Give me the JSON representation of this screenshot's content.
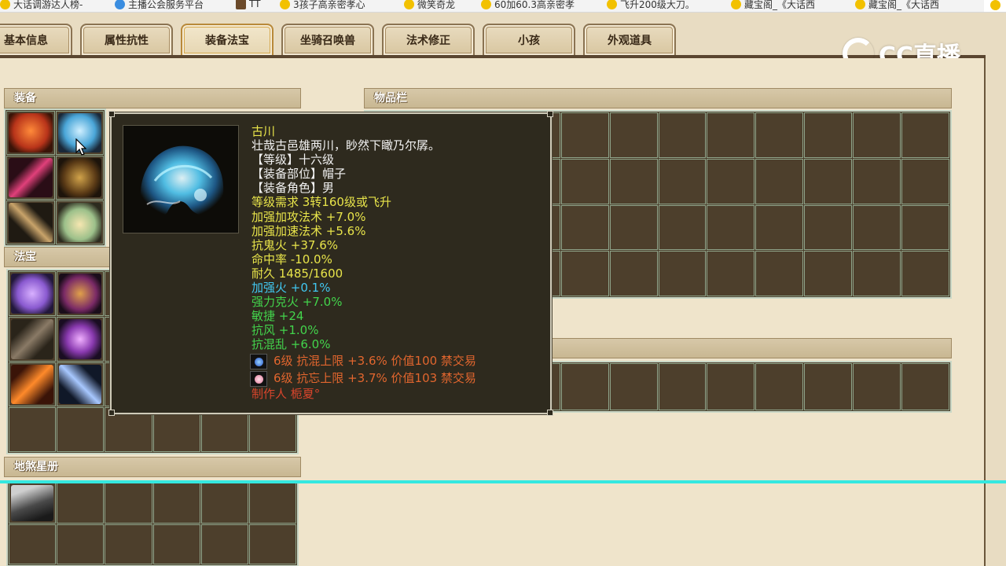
{
  "bookmarks": [
    {
      "label": "大话调游达人榜-",
      "icon": "star-icon"
    },
    {
      "label": "主播公会服务平台",
      "icon": "globe-icon"
    },
    {
      "label": "TT",
      "icon": "game-icon"
    },
    {
      "label": "3孩子高亲密孝心",
      "icon": "star-icon"
    },
    {
      "label": "微笑奇龙",
      "icon": "star-icon"
    },
    {
      "label": "60加60.3高亲密孝",
      "icon": "star-icon"
    },
    {
      "label": "飞升200级大刀。",
      "icon": "star-icon"
    },
    {
      "label": "藏宝阁_《大话西",
      "icon": "star-icon"
    },
    {
      "label": "藏宝阁_《大话西",
      "icon": "star-icon"
    }
  ],
  "tabs": [
    {
      "label": "基本信息"
    },
    {
      "label": "属性抗性"
    },
    {
      "label": "装备法宝"
    },
    {
      "label": "坐骑召唤兽"
    },
    {
      "label": "法术修正"
    },
    {
      "label": "小孩"
    },
    {
      "label": "外观道具"
    }
  ],
  "active_tab": "装备法宝",
  "logo": {
    "text": "CC直播"
  },
  "sections": {
    "equipment": "装备",
    "fabao": "法宝",
    "inventory": "物品栏",
    "disha": "地煞星册"
  },
  "tooltip": {
    "name": "古川",
    "description": "壮哉古邑雄两川，眇然下瞰乃尔孱。",
    "lines": [
      {
        "text": "【等级】十六级",
        "color": "white"
      },
      {
        "text": "【装备部位】帽子",
        "color": "white"
      },
      {
        "text": "【装备角色】男",
        "color": "white"
      },
      {
        "text": "等级需求 3转160级或飞升",
        "color": "yellow"
      },
      {
        "text": "加强加攻法术 +7.0%",
        "color": "yellow"
      },
      {
        "text": "加强加速法术 +5.6%",
        "color": "yellow"
      },
      {
        "text": "抗鬼火 +37.6%",
        "color": "yellow"
      },
      {
        "text": "命中率 -10.0%",
        "color": "yellow"
      },
      {
        "text": "耐久 1485/1600",
        "color": "yellow"
      },
      {
        "text": "加强火 +0.1%",
        "color": "blue"
      },
      {
        "text": "强力克火 +7.0%",
        "color": "green"
      },
      {
        "text": "敏捷 +24",
        "color": "green"
      },
      {
        "text": "抗风 +1.0%",
        "color": "green"
      },
      {
        "text": "抗混乱 +6.0%",
        "color": "green"
      }
    ],
    "gems": [
      {
        "text": "6级 抗混上限 +3.6% 价值100 禁交易",
        "icon": "blue-gem-icon"
      },
      {
        "text": "6级 抗忘上限 +3.7% 价值103 禁交易",
        "icon": "pink-gem-icon"
      }
    ],
    "maker": "制作人 栀夏°"
  }
}
